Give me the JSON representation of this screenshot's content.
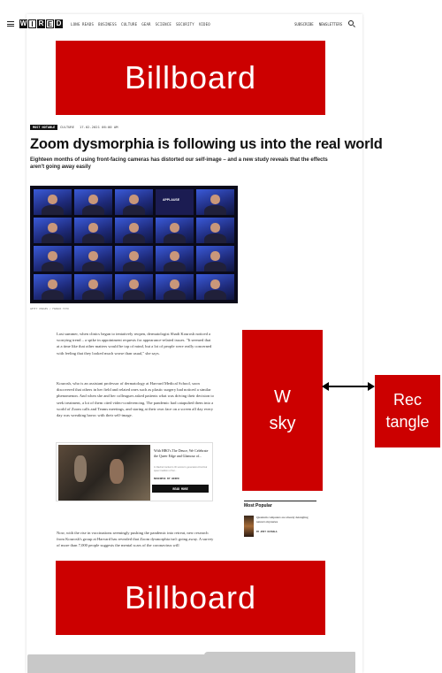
{
  "header": {
    "logo_letters": [
      "W",
      "I",
      "R",
      "E",
      "D"
    ],
    "nav": [
      "LONG READS",
      "BUSINESS",
      "CULTURE",
      "GEAR",
      "SCIENCE",
      "SECURITY",
      "VIDEO"
    ],
    "nav_right": [
      "SUBSCRIBE",
      "NEWSLETTERS"
    ]
  },
  "ads": {
    "billboard_top": "Billboard",
    "billboard_bottom": "Billboard",
    "wsky": "W\nsky",
    "rectangle": "Rec\ntangle"
  },
  "article": {
    "tag": "MOST NOTABLE",
    "section": "CULTURE",
    "date": "17.02.2021 06:00 AM",
    "headline": "Zoom dysmorphia is following us into the real world",
    "dek": "Eighteen months of using front-facing cameras has distorted our self-image – and a new study reveals that the effects aren't going away easily",
    "hero_caption": "GETTY IMAGES / FRANCK TITO",
    "hero_label": "APPLAUSE",
    "p1": "Last summer, when clinics began to tentatively reopen, dermatologist Shadi Kourosh noticed a worrying trend – a spike in appointment requests for appearance-related issues. \"It seemed that at a time like that other matters would be top of mind, but a lot of people were really concerned with feeling that they looked much worse than usual,\" she says.",
    "p2": "Kourosh, who is an assistant professor of dermatology at Harvard Medical School, soon discovered that others in her field and related ones such as plastic surgery had noticed a similar phenomenon. And when she and her colleagues asked patients what was driving their decision to seek treatment, a lot of them cited video-conferencing. The pandemic had catapulted them into a world of Zoom calls and Teams meetings, and staring at their own face on a screen all day every day was wreaking havoc with their self-image.",
    "p3": "Now, with the rise in vaccinations seemingly pushing the pandemic into retreat, new research from Kourosh's group at Harvard has revealed that Zoom dysmorphia isn't going away. A survey of more than 7,000 people suggests the mental scars of the coronavirus will"
  },
  "related": {
    "title": "With HBO's The Deuce, We Celebrate the Queer Edge and Glamour of...",
    "subtitle": "In Rachel Carlson's ID version's generation-first-final queer tradition of her...",
    "tag": "BUSINESS BY WIRED",
    "button": "READ MORE"
  },
  "sidebar": {
    "most_popular": "Most Popular",
    "item_title": "Quantum computers are already detangling nature's mysteries",
    "item_author": "BY AMIT KATWALA"
  }
}
